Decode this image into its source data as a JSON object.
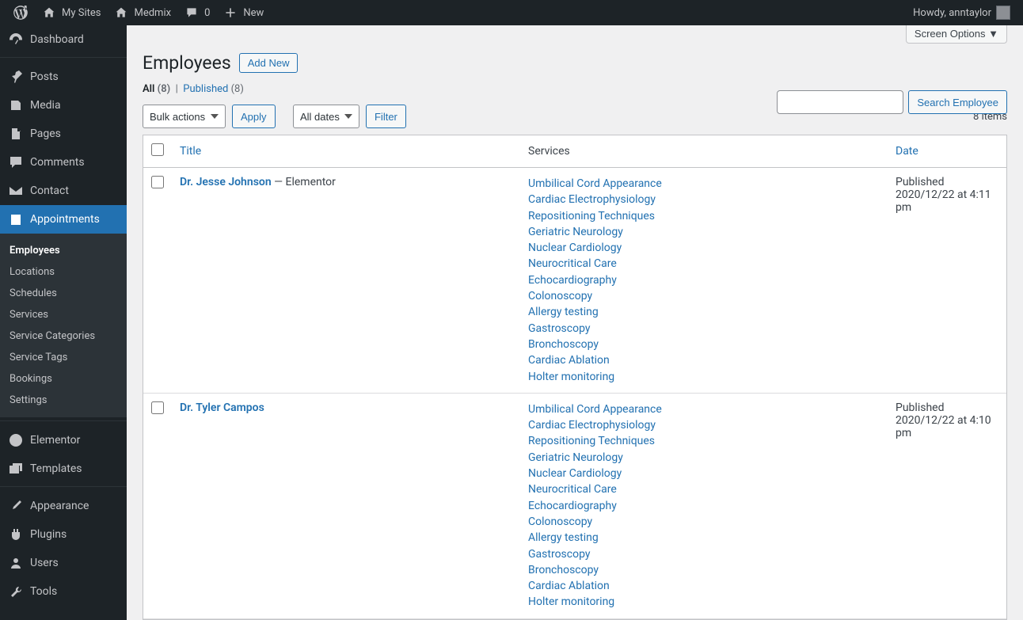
{
  "adminBar": {
    "mySites": "My Sites",
    "site": "Medmix",
    "comments": "0",
    "new": "New",
    "howdy": "Howdy, anntaylor"
  },
  "sidebar": {
    "dashboard": "Dashboard",
    "posts": "Posts",
    "media": "Media",
    "pages": "Pages",
    "comments": "Comments",
    "contact": "Contact",
    "appointments": "Appointments",
    "submenu": {
      "employees": "Employees",
      "locations": "Locations",
      "schedules": "Schedules",
      "services": "Services",
      "serviceCategories": "Service Categories",
      "serviceTags": "Service Tags",
      "bookings": "Bookings",
      "settings": "Settings"
    },
    "elementor": "Elementor",
    "templates": "Templates",
    "appearance": "Appearance",
    "plugins": "Plugins",
    "users": "Users",
    "tools": "Tools"
  },
  "screenOptions": "Screen Options ▼",
  "page": {
    "title": "Employees",
    "addNew": "Add New"
  },
  "filters": {
    "all": "All",
    "allCount": "(8)",
    "published": "Published",
    "publishedCount": "(8)",
    "bulkActions": "Bulk actions",
    "apply": "Apply",
    "allDates": "All dates",
    "filter": "Filter",
    "itemCount": "8 items",
    "searchBtn": "Search Employee"
  },
  "table": {
    "headers": {
      "title": "Title",
      "services": "Services",
      "date": "Date"
    },
    "rows": [
      {
        "title": "Dr. Jesse Johnson",
        "suffix": " — Elementor",
        "services": [
          "Umbilical Cord Appearance",
          "Cardiac Electrophysiology",
          "Repositioning Techniques",
          "Geriatric Neurology",
          "Nuclear Cardiology",
          "Neurocritical Care",
          "Echocardiography",
          "Colonoscopy",
          "Allergy testing",
          "Gastroscopy",
          "Bronchoscopy",
          "Cardiac Ablation",
          "Holter monitoring"
        ],
        "status": "Published",
        "datetime": "2020/12/22 at 4:11 pm"
      },
      {
        "title": "Dr. Tyler Campos",
        "suffix": "",
        "services": [
          "Umbilical Cord Appearance",
          "Cardiac Electrophysiology",
          "Repositioning Techniques",
          "Geriatric Neurology",
          "Nuclear Cardiology",
          "Neurocritical Care",
          "Echocardiography",
          "Colonoscopy",
          "Allergy testing",
          "Gastroscopy",
          "Bronchoscopy",
          "Cardiac Ablation",
          "Holter monitoring"
        ],
        "status": "Published",
        "datetime": "2020/12/22 at 4:10 pm"
      }
    ]
  }
}
